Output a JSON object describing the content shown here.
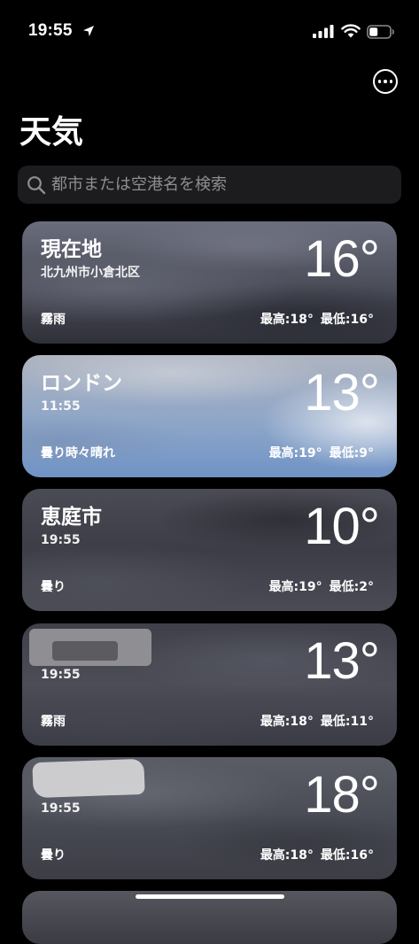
{
  "status_bar": {
    "time": "19:55"
  },
  "header": {
    "title": "天気"
  },
  "search": {
    "placeholder": "都市または空港名を検索"
  },
  "locations": [
    {
      "name": "現在地",
      "subtitle": "北九州市小倉北区",
      "temperature": "16°",
      "condition": "霧雨",
      "high": "最高:18°",
      "low": "最低:16°"
    },
    {
      "name": "ロンドン",
      "subtitle": "11:55",
      "temperature": "13°",
      "condition": "曇り時々晴れ",
      "high": "最高:19°",
      "low": "最低:9°"
    },
    {
      "name": "恵庭市",
      "subtitle": "19:55",
      "temperature": "10°",
      "condition": "曇り",
      "high": "最高:19°",
      "low": "最低:2°"
    },
    {
      "name": "",
      "subtitle": "19:55",
      "temperature": "13°",
      "condition": "霧雨",
      "high": "最高:18°",
      "low": "最低:11°"
    },
    {
      "name": "",
      "subtitle": "19:55",
      "temperature": "18°",
      "condition": "曇り",
      "high": "最高:18°",
      "low": "最低:16°"
    }
  ]
}
